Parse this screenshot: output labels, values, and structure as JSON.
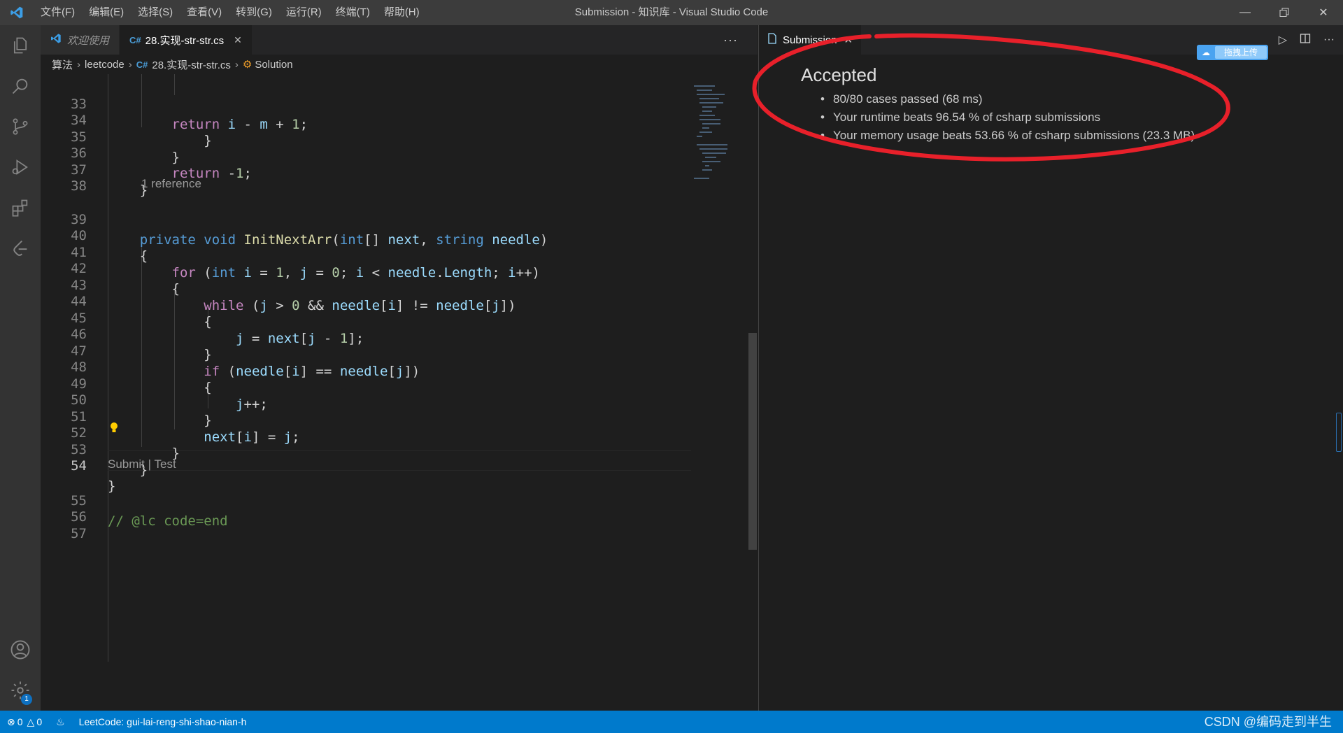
{
  "window": {
    "title": "Submission - 知识库 - Visual Studio Code"
  },
  "menu": [
    "文件(F)",
    "编辑(E)",
    "选择(S)",
    "查看(V)",
    "转到(G)",
    "运行(R)",
    "终端(T)",
    "帮助(H)"
  ],
  "activity_icons": [
    "explorer-icon",
    "search-icon",
    "source-control-icon",
    "run-debug-icon",
    "extensions-icon",
    "leetcode-icon"
  ],
  "account_icon": "account-icon",
  "settings_badge": "1",
  "tabs": [
    {
      "label": "欢迎使用",
      "active": false
    },
    {
      "label": "28.实现-str-str.cs",
      "icon": "C#",
      "active": true
    }
  ],
  "breadcrumb": [
    "算法",
    "leetcode",
    "28.实现-str-str.cs",
    "Solution"
  ],
  "breadcrumb_icon": "C#",
  "code_lines": [
    {
      "n": "33",
      "text": "        return i - m + 1;"
    },
    {
      "n": "34",
      "text": "    }"
    },
    {
      "n": "35",
      "text": "}"
    },
    {
      "n": "36",
      "text": "return -1;"
    },
    {
      "n": "37",
      "text": "}"
    },
    {
      "n": "38",
      "text": ""
    },
    {
      "n": "39",
      "text": "private void InitNextArr(int[] next, string needle)"
    },
    {
      "n": "40",
      "text": "{"
    },
    {
      "n": "41",
      "text": "for (int i = 1, j = 0; i < needle.Length; i++)"
    },
    {
      "n": "42",
      "text": "{"
    },
    {
      "n": "43",
      "text": "while (j > 0 && needle[i] != needle[j])"
    },
    {
      "n": "44",
      "text": "{"
    },
    {
      "n": "45",
      "text": "j = next[j - 1];"
    },
    {
      "n": "46",
      "text": "}"
    },
    {
      "n": "47",
      "text": "if (needle[i] == needle[j])"
    },
    {
      "n": "48",
      "text": "{"
    },
    {
      "n": "49",
      "text": "j++;"
    },
    {
      "n": "50",
      "text": "}"
    },
    {
      "n": "51",
      "text": "next[i] = j;"
    },
    {
      "n": "52",
      "text": "}"
    },
    {
      "n": "53",
      "text": "}"
    },
    {
      "n": "54",
      "text": "}"
    },
    {
      "n": "55",
      "text": "// @lc code=end"
    },
    {
      "n": "56",
      "text": ""
    },
    {
      "n": "57",
      "text": ""
    }
  ],
  "codelens": {
    "reference": "1 reference",
    "submit": "Submit",
    "separator": "|",
    "test": "Test"
  },
  "right_tab": {
    "label": "Submission"
  },
  "upload_button": "拖拽上传",
  "result": {
    "title": "Accepted",
    "items": [
      "80/80 cases passed (68 ms)",
      "Your runtime beats 96.54 % of csharp submissions",
      "Your memory usage beats 53.66 % of csharp submissions (23.3 MB)"
    ]
  },
  "status": {
    "errors": "0",
    "warnings": "0",
    "leetcode": "LeetCode: gui-lai-reng-shi-shao-nian-h"
  },
  "watermark": "CSDN @编码走到半生",
  "colors": {
    "statusbar": "#007acc",
    "annotation": "#e8202a",
    "accent": "#0e70c0"
  }
}
